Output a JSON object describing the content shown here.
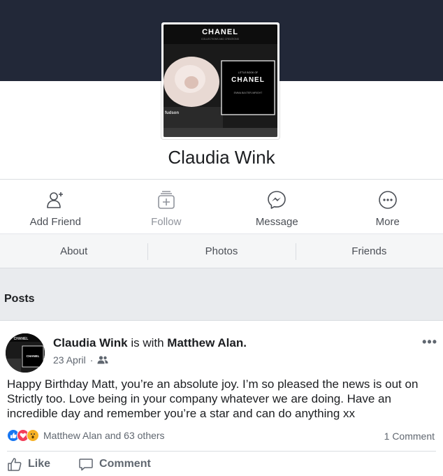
{
  "profile": {
    "name": "Claudia Wink",
    "picture": {
      "brand_top": "CHANEL",
      "brand_top_sub": "COLLECTIONS AND CREATIONS",
      "book_small": "LITTLE BOOK OF",
      "book_brand": "CHANEL",
      "book_author": "EMMA BAXTER-WRIGHT",
      "spine_text": "fudson"
    }
  },
  "actions": [
    {
      "label": "Add Friend",
      "icon": "add-friend-icon"
    },
    {
      "label": "Follow",
      "icon": "follow-icon"
    },
    {
      "label": "Message",
      "icon": "messenger-icon"
    },
    {
      "label": "More",
      "icon": "more-icon"
    }
  ],
  "tabs": [
    "About",
    "Photos",
    "Friends"
  ],
  "section": {
    "title": "Posts"
  },
  "post": {
    "author": "Claudia Wink",
    "with_text": "is with",
    "tagged": "Matthew Alan.",
    "date": "23 April",
    "audience_icon": "friends-icon",
    "text": "Happy Birthday Matt, you’re an absolute joy. I’m so pleased the news is out on Strictly too. Love being in your company whatever we are doing. Have an incredible day and remember you’re a star and can do anything xx",
    "reactions_text": "Matthew Alan and 63 others",
    "comments_text": "1 Comment",
    "like_label": "Like",
    "comment_label": "Comment",
    "avatar": {
      "brand_top": "CHANEL",
      "brand_inner": "CHANEL"
    }
  }
}
